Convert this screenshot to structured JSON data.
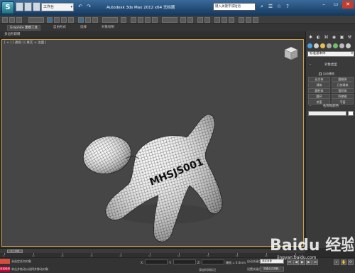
{
  "titlebar": {
    "app_title": "Autodesk 3ds Max  2012 x64    无标题",
    "workspace": "工作台",
    "search_placeholder": "键入关键字或短语"
  },
  "ribbon": {
    "tabs": [
      "Graphite 建模工具",
      "自由形式",
      "选择",
      "对象绘制"
    ],
    "subtitle": "多边形建模"
  },
  "viewport": {
    "label": "[ + ] [ 透视 ] [ 真实 + 边面 ]",
    "model_text": "MHSJS001"
  },
  "command_panel": {
    "dropdown": "标准基本体",
    "rollout_object_type": "对象类型",
    "auto_grid": "自动栅格",
    "buttons": [
      "长方体",
      "圆锥体",
      "球体",
      "几何球体",
      "圆柱体",
      "管状体",
      "圆环",
      "四棱锥",
      "茶壶",
      "平面"
    ],
    "rollout_name_color": "名称和颜色"
  },
  "timeline": {
    "frame": "0 / 100",
    "ticks": [
      "0",
      "10",
      "20",
      "30",
      "40",
      "50",
      "60",
      "70",
      "80",
      "90",
      "100"
    ]
  },
  "status": {
    "line1": "未选定任何对象",
    "line2": "单击并拖动以选择并移动对象",
    "maxscript": "欢迎使用",
    "x_label": "X:",
    "y_label": "Y:",
    "z_label": "Z:",
    "grid": "栅格 = 0.0mm",
    "auto_key": "自动关键点",
    "set_key": "设置关键点",
    "selected": "选定对象",
    "key_filters": "关键点过滤器...",
    "add_time_tag": "添加时间标记"
  },
  "watermark": {
    "brand": "Baidu 经验",
    "url": "jingyan.baidu.com"
  }
}
